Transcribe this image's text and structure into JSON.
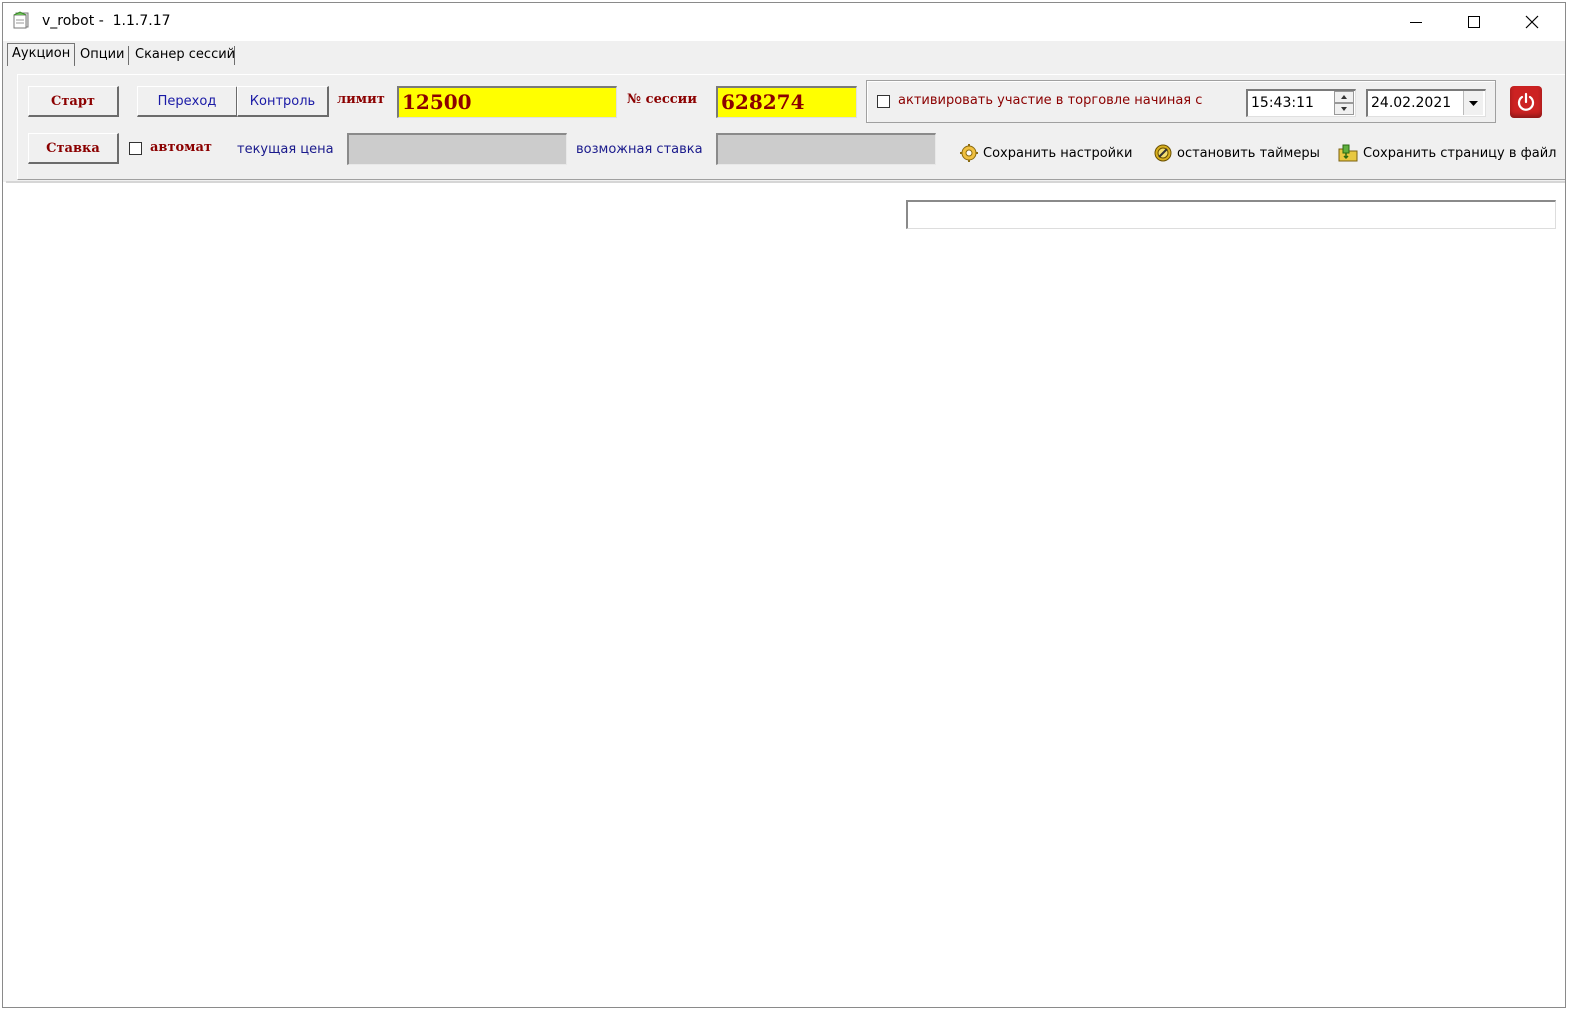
{
  "window": {
    "title": "v_robot -  1.1.7.17",
    "icon": "app-document-icon"
  },
  "tabs": [
    {
      "label": "Аукцион",
      "active": true
    },
    {
      "label": "Опции",
      "active": false
    },
    {
      "label": "Сканер сессий",
      "active": false
    }
  ],
  "toolbar": {
    "start_label": "Старт",
    "goto_label": "Переход",
    "control_label": "Контроль",
    "limit_label": "лимит",
    "limit_value": "12500",
    "session_label": "№ сессии",
    "session_value": "628274",
    "activate_label": "активировать участие в торговле начиная с",
    "activate_checked": false,
    "time_value": "15:43:11",
    "date_value": "24.02.2021",
    "bid_label": "Ставка",
    "auto_label": "автомат",
    "auto_checked": false,
    "current_price_label": "текущая цена",
    "current_price_value": "",
    "possible_bid_label": "возможная ставка",
    "possible_bid_value": "",
    "save_settings_label": "Сохранить настройки",
    "stop_timers_label": "остановить таймеры",
    "save_page_label": "Сохранить страницу в файл"
  },
  "status": {
    "value": ""
  },
  "colors": {
    "accent_yellow": "#ffff00",
    "dark_red": "#8b0000",
    "navy": "#1a1a8c",
    "power_red": "#cc2222"
  }
}
